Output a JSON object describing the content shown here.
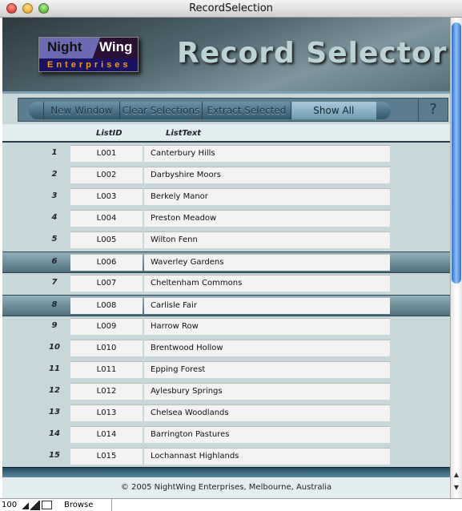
{
  "window": {
    "title": "RecordSelection"
  },
  "header": {
    "logo_line1a": "Night",
    "logo_line1b": "Wing",
    "logo_line2": "Enterprises",
    "title": "Record Selector"
  },
  "toolbar": {
    "buttons": [
      "New Window",
      "Clear Selections",
      "Extract Selected",
      "Show All"
    ],
    "active": "Show All",
    "help": "?"
  },
  "columns": {
    "id": "ListID",
    "text": "ListText"
  },
  "rows": [
    {
      "n": "1",
      "id": "L001",
      "text": "Canterbury Hills",
      "selected": false
    },
    {
      "n": "2",
      "id": "L002",
      "text": "Darbyshire Moors",
      "selected": false
    },
    {
      "n": "3",
      "id": "L003",
      "text": "Berkely Manor",
      "selected": false
    },
    {
      "n": "4",
      "id": "L004",
      "text": "Preston Meadow",
      "selected": false
    },
    {
      "n": "5",
      "id": "L005",
      "text": "Wilton Fenn",
      "selected": false
    },
    {
      "n": "6",
      "id": "L006",
      "text": "Waverley Gardens",
      "selected": true
    },
    {
      "n": "7",
      "id": "L007",
      "text": "Cheltenham Commons",
      "selected": false
    },
    {
      "n": "8",
      "id": "L008",
      "text": "Carlisle Fair",
      "selected": true
    },
    {
      "n": "9",
      "id": "L009",
      "text": "Harrow Row",
      "selected": false
    },
    {
      "n": "10",
      "id": "L010",
      "text": "Brentwood Hollow",
      "selected": false
    },
    {
      "n": "11",
      "id": "L011",
      "text": "Epping Forest",
      "selected": false
    },
    {
      "n": "12",
      "id": "L012",
      "text": "Aylesbury Springs",
      "selected": false
    },
    {
      "n": "13",
      "id": "L013",
      "text": "Chelsea Woodlands",
      "selected": false
    },
    {
      "n": "14",
      "id": "L014",
      "text": "Barrington Pastures",
      "selected": false
    },
    {
      "n": "15",
      "id": "L015",
      "text": "Lochannast Highlands",
      "selected": false
    }
  ],
  "footer": {
    "text": "© 2005 NightWing Enterprises, Melbourne, Australia"
  },
  "status": {
    "zoom": "100",
    "mode": "Browse"
  }
}
